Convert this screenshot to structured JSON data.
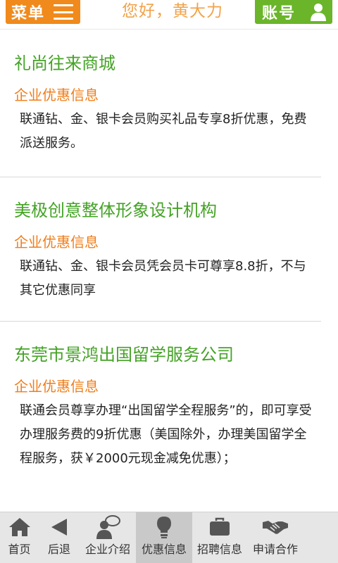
{
  "header": {
    "menu_label": "菜单",
    "greeting": "您好，黄大力",
    "account_label": "账号",
    "colors": {
      "menu_bg": "#f08a1c",
      "account_bg": "#6ab52a",
      "greeting": "#f2a34a"
    }
  },
  "offers": [
    {
      "name": "礼尚往来商城",
      "tag": "企业优惠信息",
      "desc": "联通钻、金、银卡会员购买礼品专享8折优惠，免费派送服务。"
    },
    {
      "name": "美极创意整体形象设计机构",
      "tag": "企业优惠信息",
      "desc": "联通钻、金、银卡会员凭会员卡可尊享8.8折，不与其它优惠同享"
    },
    {
      "name": "东莞市景鸿出国留学服务公司",
      "tag": "企业优惠信息",
      "desc": "联通会员尊享办理“出国留学全程服务”的，即可享受办理服务费的9折优惠（美国除外，办理美国留学全程服务，获￥2000元现金减免优惠）；"
    }
  ],
  "bottom_nav": [
    {
      "label": "首页",
      "icon": "home-icon"
    },
    {
      "label": "后退",
      "icon": "back-arrow-icon"
    },
    {
      "label": "企业介绍",
      "icon": "person-chat-icon"
    },
    {
      "label": "优惠信息",
      "icon": "lightbulb-icon",
      "active": true
    },
    {
      "label": "招聘信息",
      "icon": "briefcase-icon"
    },
    {
      "label": "申请合作",
      "icon": "handshake-icon"
    }
  ],
  "colors": {
    "name_green": "#44a326",
    "tag_orange": "#f07d1a",
    "nav_bg": "#e6e6e6",
    "nav_active_bg": "#c9c9c9"
  }
}
